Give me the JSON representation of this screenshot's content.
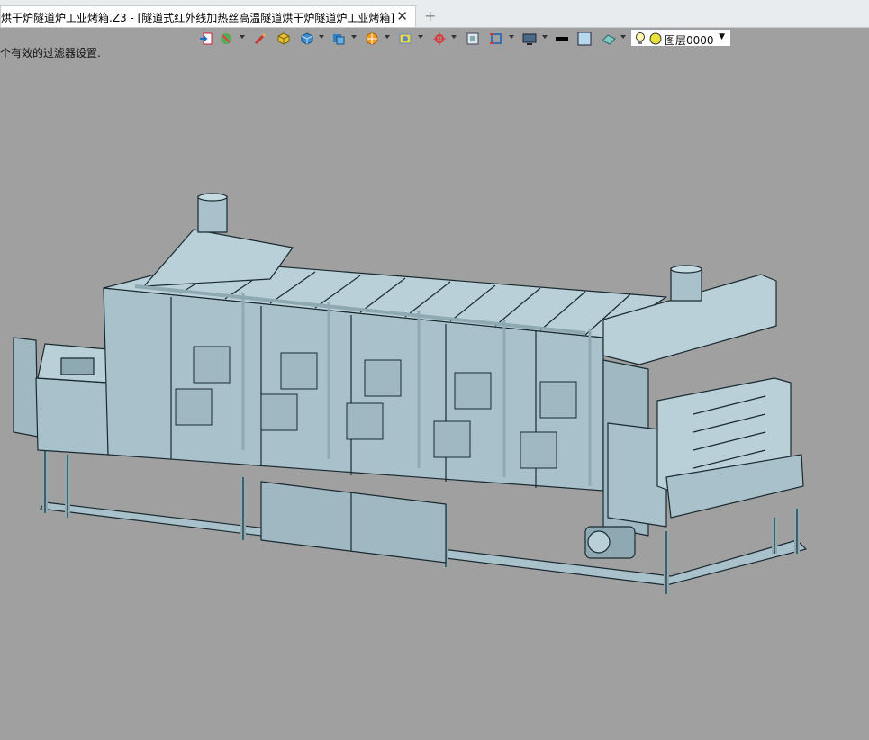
{
  "tabs": [
    {
      "label": "烘干炉隧道炉工业烤箱.Z3 - [隧道式红外线加热丝高温隧道烘干炉隧道炉工业烤箱]",
      "active": true
    }
  ],
  "tab_close_glyph": "✕",
  "tab_add_glyph": "+",
  "toolbar": {
    "icons": [
      "import-icon",
      "color-paint-icon",
      "brush-icon",
      "solid-box-icon",
      "cube-icon",
      "layer-cube-icon",
      "orange-sphere-icon",
      "snapshot-icon",
      "axis-cross-icon",
      "frame-icon",
      "red-frame-icon",
      "monitor-icon",
      "line-style-icon",
      "fill-square-icon",
      "eraser-icon"
    ],
    "layer": {
      "value": "图层0000",
      "arrow": "▼"
    }
  },
  "status_message": "个有效的过滤器设置.",
  "colors": {
    "viewport_bg": "#a0a0a0",
    "model_fill": "#a9c1cb",
    "model_dark": "#7f9aa5",
    "model_line": "#1a2a30"
  }
}
